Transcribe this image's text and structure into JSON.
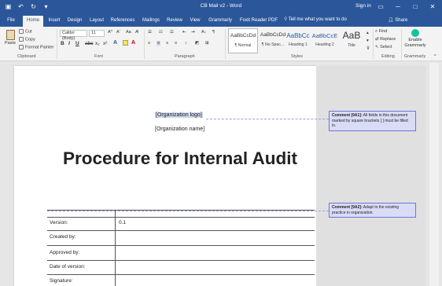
{
  "titlebar": {
    "document_title": "CB Mail v2 - Word",
    "sign_in": "Sign in",
    "qat_icons": [
      "save-icon",
      "undo-icon",
      "redo-icon",
      "customize-icon"
    ]
  },
  "tabs": [
    "File",
    "Home",
    "Insert",
    "Design",
    "Layout",
    "References",
    "Mailings",
    "Review",
    "View",
    "Grammarly",
    "Foxit Reader PDF"
  ],
  "active_tab": "Home",
  "tell_me": "Tell me what you want to do",
  "share": "Share",
  "ribbon": {
    "clipboard": {
      "paste": "Paste",
      "cut": "Cut",
      "copy": "Copy",
      "format_painter": "Format Painter",
      "label": "Clipboard"
    },
    "font": {
      "name": "Calibri (Body)",
      "size": "11",
      "label": "Font",
      "buttons": [
        "B",
        "I",
        "U",
        "abc",
        "x₂",
        "x²"
      ]
    },
    "paragraph": {
      "label": "Paragraph"
    },
    "styles": {
      "label": "Styles",
      "items": [
        {
          "sample": "AaBbCcDd",
          "name": "¶ Normal"
        },
        {
          "sample": "AaBbCcDd",
          "name": "¶ No Spac..."
        },
        {
          "sample": "AaBbCc",
          "name": "Heading 1"
        },
        {
          "sample": "AaBbCcE",
          "name": "Heading 2"
        },
        {
          "sample": "AaB",
          "name": "Title"
        }
      ]
    },
    "editing": {
      "find": "Find",
      "replace": "Replace",
      "select": "Select",
      "label": "Editing"
    },
    "grammarly": {
      "enable": "Enable Grammarly",
      "label": "Grammarly"
    }
  },
  "document": {
    "org_logo": "[Organization logo]",
    "org_name": "[Organization name]",
    "title": "Procedure for Internal Audit",
    "table_rows": [
      {
        "label": "Version:",
        "value": "0.1"
      },
      {
        "label": "Created by:",
        "value": ""
      },
      {
        "label": "Approved by:",
        "value": ""
      },
      {
        "label": "Date of version:",
        "value": ""
      },
      {
        "label": "Signature:",
        "value": ""
      }
    ]
  },
  "comments": [
    {
      "author": "Comment [9A1]:",
      "text": "All fields in this document marked by square brackets [ ] must be filled in."
    },
    {
      "author": "Comment [9A2]:",
      "text": "Adapt to the existing practice in organization."
    }
  ],
  "colors": {
    "word_blue": "#2b579a",
    "comment_bg": "#d9dcf7",
    "comment_border": "#6f74d6"
  }
}
